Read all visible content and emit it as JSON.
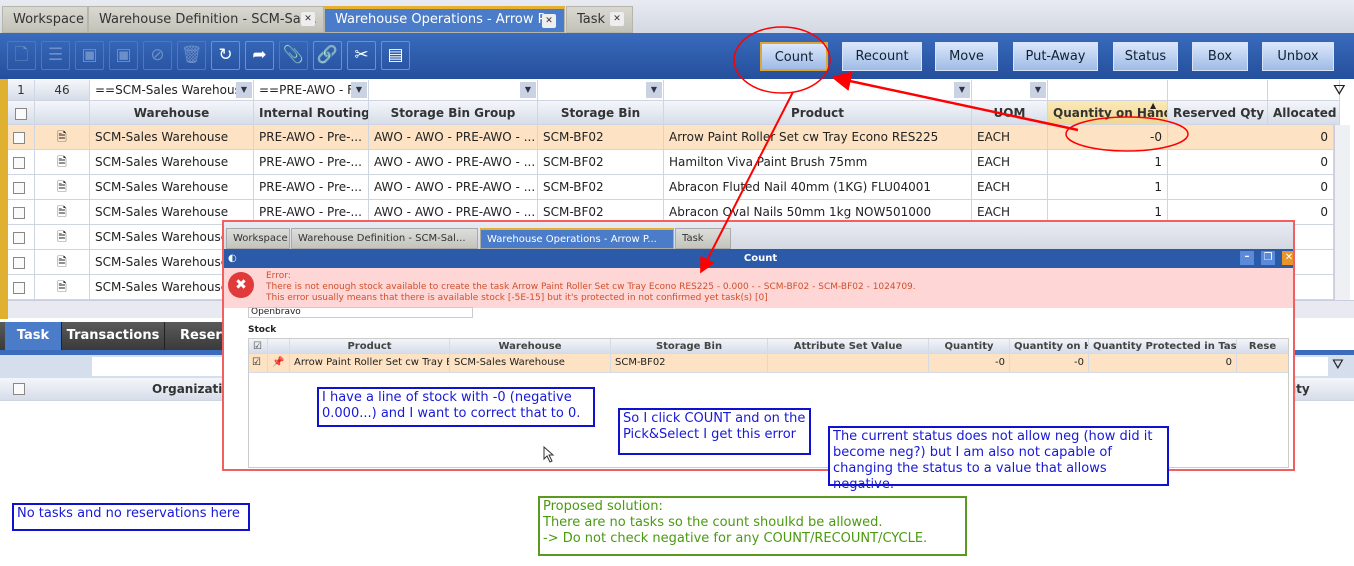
{
  "tabs": [
    {
      "label": "Workspace"
    },
    {
      "label": "Warehouse Definition - SCM-Sal..."
    },
    {
      "label": "Warehouse Operations - Arrow P..."
    },
    {
      "label": "Task"
    }
  ],
  "toolbar": {
    "icons": [
      "new-doc-icon",
      "new-row-icon",
      "save-icon",
      "save-close-icon",
      "undo-icon",
      "delete-icon",
      "refresh-icon",
      "export-icon",
      "attach-icon",
      "link-icon",
      "tools-icon",
      "layout-icon"
    ],
    "buttons": [
      "Count",
      "Recount",
      "Move",
      "Put-Away",
      "Status",
      "Box",
      "Unbox"
    ]
  },
  "grid": {
    "record_num": "1",
    "record_count": "46",
    "filters": [
      "==SCM-Sales Warehouse",
      "==PRE-AWO - F"
    ],
    "headers": [
      "Warehouse",
      "Internal Routing ...",
      "Storage Bin Group",
      "Storage Bin",
      "Product",
      "UOM",
      "Quantity on Hand",
      "Reserved Qty",
      "Allocated Q"
    ],
    "rows": [
      [
        "SCM-Sales Warehouse",
        "PRE-AWO - Pre-...",
        "AWO - AWO - PRE-AWO - ...",
        "SCM-BF02",
        "Arrow Paint Roller Set cw Tray Econo RES225",
        "EACH",
        "-0",
        "0"
      ],
      [
        "SCM-Sales Warehouse",
        "PRE-AWO - Pre-...",
        "AWO - AWO - PRE-AWO - ...",
        "SCM-BF02",
        "Hamilton Viva Paint Brush 75mm",
        "EACH",
        "1",
        "0"
      ],
      [
        "SCM-Sales Warehouse",
        "PRE-AWO - Pre-...",
        "AWO - AWO - PRE-AWO - ...",
        "SCM-BF02",
        "Abracon Fluted Nail 40mm (1KG) FLU04001",
        "EACH",
        "1",
        "0"
      ],
      [
        "SCM-Sales Warehouse",
        "PRE-AWO - Pre-...",
        "AWO - AWO - PRE-AWO - ...",
        "SCM-BF02",
        "Abracon Oval Nails 50mm 1kg NOW501000",
        "EACH",
        "1",
        "0"
      ],
      [
        "SCM-Sales Warehouse",
        "",
        "",
        "",
        "",
        "",
        "",
        ""
      ],
      [
        "SCM-Sales Warehouse",
        "",
        "",
        "",
        "",
        "",
        "",
        ""
      ],
      [
        "SCM-Sales Warehouse",
        "",
        "",
        "",
        "",
        "",
        "",
        ""
      ]
    ]
  },
  "bottom": {
    "tabs": [
      "Task",
      "Transactions",
      "Reservations"
    ],
    "header": "Organization",
    "header_right": "ity"
  },
  "popup": {
    "tabs": [
      "Workspace",
      "Warehouse Definition - SCM-Sal...",
      "Warehouse Operations - Arrow P...",
      "Task"
    ],
    "title": "Count",
    "error_title": "Error:",
    "error_line1": "There is not enough stock available to create the task Arrow Paint Roller Set cw Tray Econo RES225 - 0.000 - - SCM-BF02 - SCM-BF02 - 1024709.",
    "error_line2": "This error usually means that there is available stock [-5E-15] but it's protected in not confirmed yet task(s) [0]",
    "org_value": "Openbravo",
    "section": "Stock",
    "headers": [
      "Product",
      "Warehouse",
      "Storage Bin",
      "Attribute Set Value",
      "Quantity",
      "Quantity on Hand",
      "Quantity Protected in Tasks",
      "Rese"
    ],
    "row": [
      "Arrow Paint Roller Set cw Tray E...",
      "SCM-Sales Warehouse",
      "SCM-BF02",
      "",
      "-0",
      "-0",
      "0",
      ""
    ]
  },
  "annotations": {
    "a1": "I have a line of stock with -0 (negative 0.000...) and I want to correct that to 0.",
    "a2": "So I click COUNT and on the Pick&Select I get this error",
    "a3": "The current status does not allow neg (how did it become neg?) but I am also not capable of changing the status to a value that allows negative.",
    "a4": "No tasks and no reservations here",
    "g1": "Proposed solution:",
    "g2": "There are no tasks so the count shoulkd be allowed.",
    "g3": "-> Do not check negative for any COUNT/RECOUNT/CYCLE."
  },
  "colors": {
    "accent": "#2a5aa8",
    "selected_row": "#fde3c4",
    "error_bg": "#ffd6d6",
    "annotation": "#1010d0",
    "markup": "#ff0000"
  }
}
